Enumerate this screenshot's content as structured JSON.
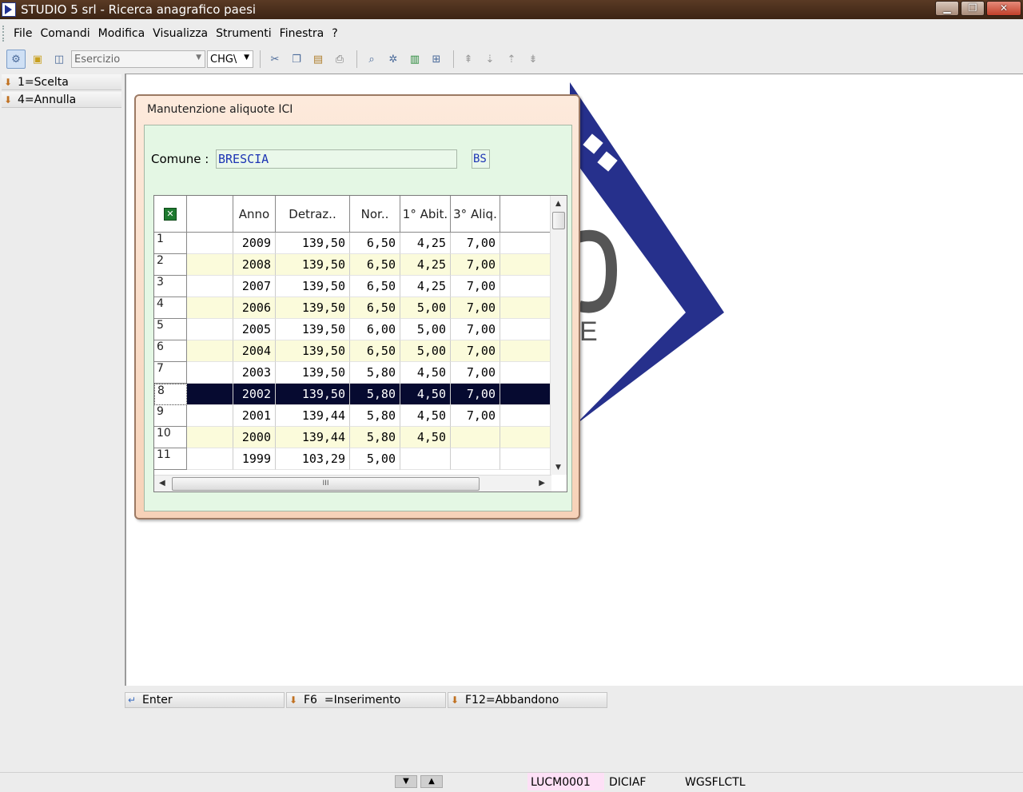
{
  "window": {
    "title": "STUDIO 5 srl - Ricerca anagrafico paesi",
    "controls": {
      "minimize": "▁",
      "maximize": "❐",
      "close": "✕"
    }
  },
  "menu": [
    "File",
    "Comandi",
    "Modifica",
    "Visualizza",
    "Strumenti",
    "Finestra",
    "?"
  ],
  "toolbar": {
    "esercizio_placeholder": "Esercizio",
    "company_combo": "CHG\\"
  },
  "functions": [
    {
      "label": "1=Scelta"
    },
    {
      "label": "4=Annulla"
    }
  ],
  "dialog": {
    "title": "Manutenzione aliquote ICI",
    "comune_label": "Comune :",
    "comune_value": "BRESCIA",
    "provincia_value": "BS",
    "grid": {
      "headers": [
        "",
        "Anno",
        "Detraz..",
        "Nor..",
        "1° Abit.",
        "3° Aliq.",
        ""
      ],
      "rows": [
        {
          "n": "1",
          "cells": [
            "",
            "2009",
            "139,50",
            "6,50",
            "4,25",
            "7,00",
            ""
          ]
        },
        {
          "n": "2",
          "cells": [
            "",
            "2008",
            "139,50",
            "6,50",
            "4,25",
            "7,00",
            ""
          ]
        },
        {
          "n": "3",
          "cells": [
            "",
            "2007",
            "139,50",
            "6,50",
            "4,25",
            "7,00",
            ""
          ]
        },
        {
          "n": "4",
          "cells": [
            "",
            "2006",
            "139,50",
            "6,50",
            "5,00",
            "7,00",
            ""
          ]
        },
        {
          "n": "5",
          "cells": [
            "",
            "2005",
            "139,50",
            "6,00",
            "5,00",
            "7,00",
            ""
          ]
        },
        {
          "n": "6",
          "cells": [
            "",
            "2004",
            "139,50",
            "6,50",
            "5,00",
            "7,00",
            ""
          ]
        },
        {
          "n": "7",
          "cells": [
            "",
            "2003",
            "139,50",
            "5,80",
            "4,50",
            "7,00",
            ""
          ]
        },
        {
          "n": "8",
          "cells": [
            "",
            "2002",
            "139,50",
            "5,80",
            "4,50",
            "7,00",
            ""
          ]
        },
        {
          "n": "9",
          "cells": [
            "",
            "2001",
            "139,44",
            "5,80",
            "4,50",
            "7,00",
            ""
          ]
        },
        {
          "n": "10",
          "cells": [
            "",
            "2000",
            "139,44",
            "5,80",
            "4,50",
            "",
            ""
          ]
        },
        {
          "n": "11",
          "cells": [
            "",
            "1999",
            "103,29",
            "5,00",
            "",
            "",
            ""
          ]
        }
      ],
      "selected_row": "8",
      "hscroll_grip": "III"
    }
  },
  "fkeys": [
    {
      "label": "Enter",
      "icon": "enter-icon"
    },
    {
      "label": "F6  =Inserimento",
      "icon": "arrow-icon"
    },
    {
      "label": "F12=Abbandono",
      "icon": "arrow-icon"
    }
  ],
  "status": {
    "user": "LUCM0001",
    "field2": "DICIAF",
    "field3": "WGSFLCTL"
  },
  "colors": {
    "titlebar": "#3c2414",
    "dialog_frame": "#f7d2b8",
    "dialog_body": "#e4f7e4",
    "row_alt": "#fbfbdb",
    "row_selected": "#060a30",
    "logo_blue": "#26308c",
    "field_text": "#1c34b4"
  }
}
